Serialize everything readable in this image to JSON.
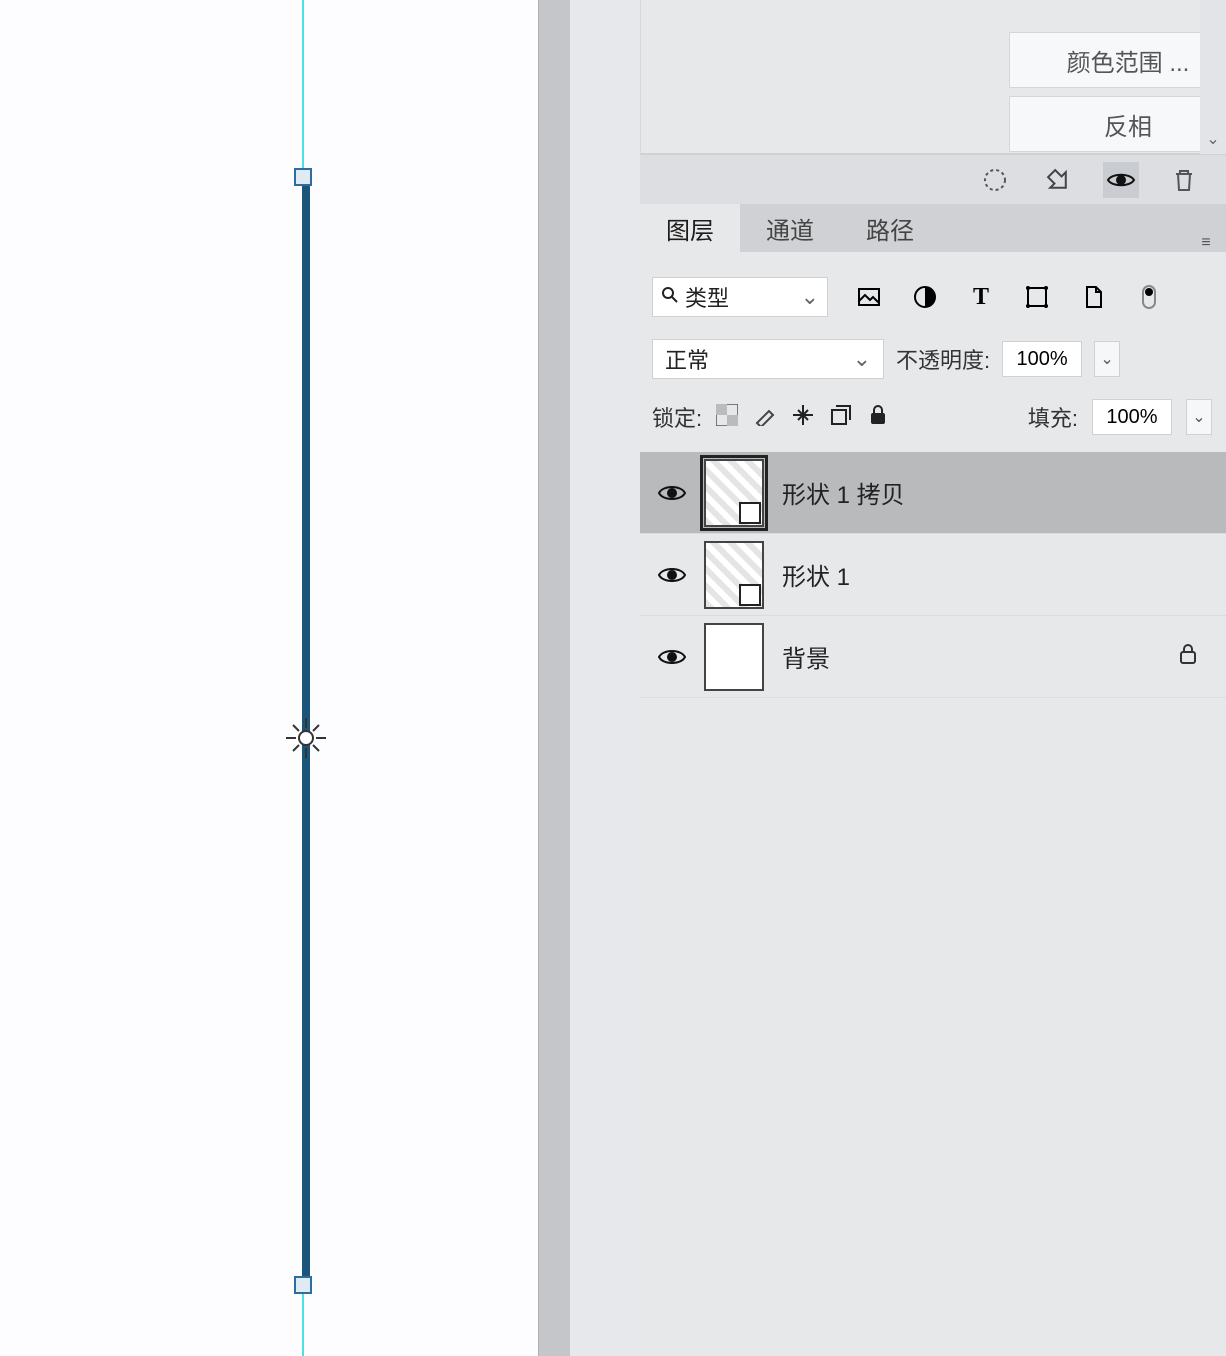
{
  "mask_panel": {
    "color_range": "颜色范围 ...",
    "invert": "反相"
  },
  "tabs": {
    "layers": "图层",
    "channels": "通道",
    "paths": "路径"
  },
  "filter": {
    "label": "类型"
  },
  "blend": {
    "mode": "正常",
    "opacity_label": "不透明度:",
    "opacity_value": "100%"
  },
  "lock": {
    "label": "锁定:",
    "fill_label": "填充:",
    "fill_value": "100%"
  },
  "layers": [
    {
      "name": "形状 1 拷贝",
      "selected": true,
      "locked": false,
      "thumb": "shape"
    },
    {
      "name": "形状 1",
      "selected": false,
      "locked": false,
      "thumb": "shape"
    },
    {
      "name": "背景",
      "selected": false,
      "locked": true,
      "thumb": "white"
    }
  ]
}
